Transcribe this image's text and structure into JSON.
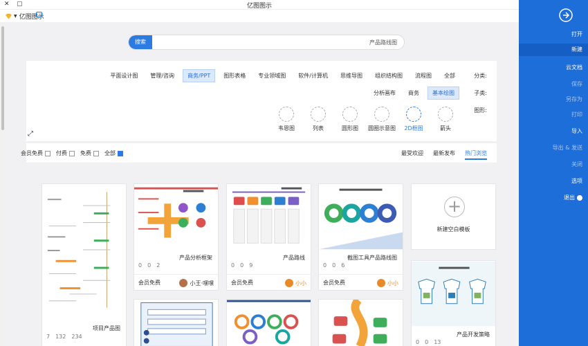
{
  "window": {
    "title": "亿图图示"
  },
  "toolbar": {
    "brand": "亿图图示"
  },
  "search": {
    "button": "搜索",
    "query": "产品路线图"
  },
  "filters": {
    "category_label": "分类:",
    "categories": [
      "全部",
      "流程图",
      "组织结构图",
      "思维导图",
      "软件/计算机",
      "专业领域图",
      "图形表格",
      "商务/PPT",
      "管理/咨询",
      "平面设计图"
    ],
    "category_selected": "商务/PPT",
    "subclass_label": "子类:",
    "subclasses": [
      "基本绘图",
      "商务",
      "分析画布"
    ],
    "subclass_selected": "基本绘图",
    "graphic_label": "图形:",
    "graphics": [
      "箭头",
      "2D框图",
      "圆圈示意图",
      "圆形图",
      "列表",
      "韦恩图"
    ],
    "graphic_selected": "2D框图"
  },
  "sort": {
    "tabs": [
      "热门浏览",
      "最新发布",
      "最受欢迎"
    ],
    "selected": "热门浏览"
  },
  "checks": [
    "全部",
    "免费",
    "付费",
    "会员免费"
  ],
  "new_template": "新建空白模板",
  "cards": [
    {
      "title": "截图工具产品路线图",
      "likes": "0",
      "thumbs": "0",
      "views": "6",
      "author": "小小",
      "fee": "会员免费"
    },
    {
      "title": "产品路线",
      "likes": "0",
      "thumbs": "0",
      "views": "9",
      "author": "小小",
      "fee": "会员免费"
    },
    {
      "title": "产品分析框架",
      "likes": "0",
      "thumbs": "0",
      "views": "2",
      "author": "小王·嘿嘿",
      "fee": "会员免费"
    },
    {
      "title": "项目产品图",
      "likes": "7",
      "thumbs": "132",
      "views": "234"
    },
    {
      "title": "产品开发策略",
      "likes": "0",
      "thumbs": "0",
      "views": "13"
    }
  ],
  "sidebar": {
    "items": [
      "打开",
      "新建",
      "云文档",
      "保存",
      "另存为",
      "打印",
      "导入",
      "导出 & 发送",
      "关闭",
      "选项",
      "退出"
    ],
    "active": "新建"
  },
  "colors": {
    "accent": "#2b7be2",
    "sidebar": "#1e6ed9"
  }
}
